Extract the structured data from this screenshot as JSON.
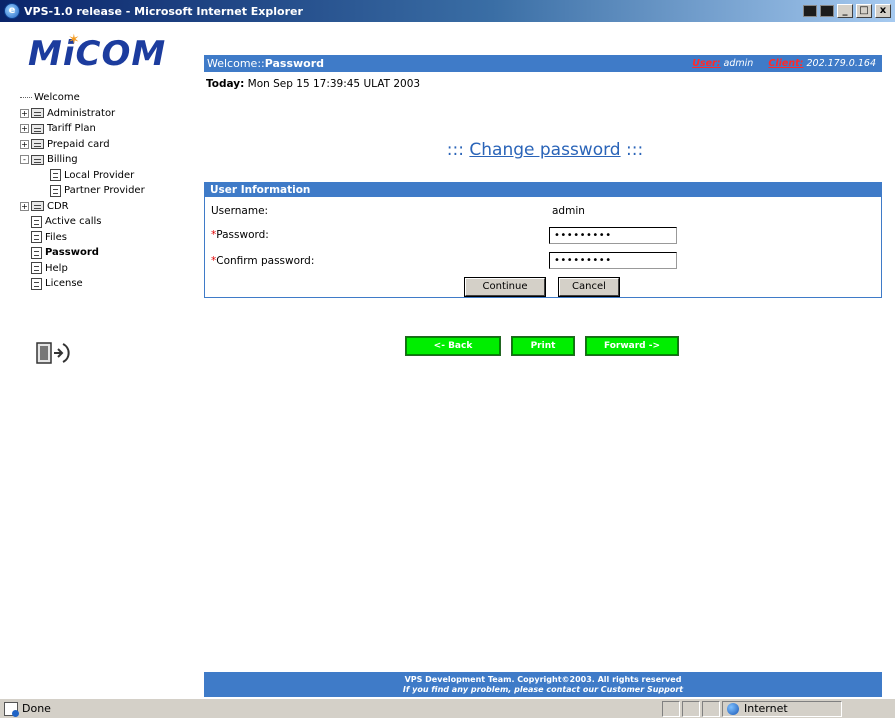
{
  "window": {
    "title": "VPS-1.0 release - Microsoft Internet Explorer",
    "minimize": "_",
    "restore": "□",
    "close": "x"
  },
  "logo": {
    "text": "MiCOM"
  },
  "nav": {
    "items": [
      {
        "label": "Welcome",
        "type": "leaf-root"
      },
      {
        "label": "Administrator",
        "type": "folder",
        "expander": "+"
      },
      {
        "label": "Tariff Plan",
        "type": "folder",
        "expander": "+"
      },
      {
        "label": "Prepaid card",
        "type": "folder",
        "expander": "+"
      },
      {
        "label": "Billing",
        "type": "folder",
        "expander": "-"
      },
      {
        "label": "Local Provider",
        "type": "child"
      },
      {
        "label": "Partner Provider",
        "type": "child"
      },
      {
        "label": "CDR",
        "type": "folder",
        "expander": "+"
      },
      {
        "label": "Active calls",
        "type": "doc"
      },
      {
        "label": "Files",
        "type": "doc"
      },
      {
        "label": "Password",
        "type": "doc",
        "active": true
      },
      {
        "label": "Help",
        "type": "doc"
      },
      {
        "label": "License",
        "type": "doc"
      }
    ]
  },
  "header": {
    "welcome_prefix": "Welcome::",
    "welcome_page": "Password",
    "user_label": "User:",
    "user_value": "admin",
    "client_label": "Client:",
    "client_value": "202.179.0.164"
  },
  "today": {
    "label": "Today:",
    "value": "Mon Sep 15 17:39:45 ULAT 2003"
  },
  "page_title": {
    "prefix": ":::",
    "link": "Change password",
    "suffix": ":::"
  },
  "form": {
    "section_title": "User Information",
    "username_label": "Username:",
    "username_value": "admin",
    "password_label": "Password:",
    "password_value": "•••••••••",
    "confirm_label": "Confirm password:",
    "confirm_value": "•••••••••",
    "required_mark": "*",
    "continue_label": "Continue",
    "cancel_label": "Cancel"
  },
  "navbuttons": {
    "back": "<- Back",
    "print": "Print",
    "forward": "Forward ->"
  },
  "footer": {
    "line1": "VPS Development Team. Copyright©2003. All rights reserved",
    "line2": "If you find any problem, please contact our Customer Support"
  },
  "status": {
    "left": "Done",
    "zone": "Internet"
  }
}
